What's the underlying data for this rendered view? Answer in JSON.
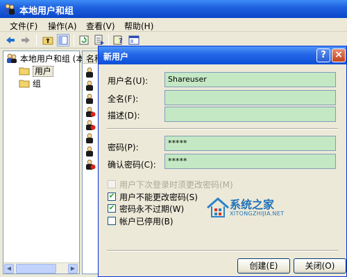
{
  "window": {
    "title": "本地用户和组"
  },
  "menu": [
    {
      "label": "文件(F)"
    },
    {
      "label": "操作(A)"
    },
    {
      "label": "查看(V)"
    },
    {
      "label": "帮助(H)"
    }
  ],
  "toolbar": {
    "buttons": [
      "back-arrow-icon",
      "forward-arrow-icon",
      "up-folder-icon",
      "show-hide-tree-icon",
      "refresh-icon",
      "export-list-icon",
      "help-icon",
      "mmc-console-icon"
    ]
  },
  "tree": {
    "root_label": "本地用户和组 (本",
    "items": [
      {
        "label": "用户"
      },
      {
        "label": "组"
      }
    ]
  },
  "list": {
    "header": "名称",
    "row_count": 8
  },
  "dialog": {
    "title": "新用户",
    "help_button": "?",
    "close_button": "×",
    "username_label": "用户名(U):",
    "username_value": "Shareuser",
    "fullname_label": "全名(F):",
    "fullname_value": "",
    "description_label": "描述(D):",
    "description_value": "",
    "password_label": "密码(P):",
    "password_value": "*****",
    "confirm_label": "确认密码(C):",
    "confirm_value": "*****",
    "checkboxes": [
      {
        "label": "用户下次登录时须更改密码(M)",
        "checked": false,
        "enabled": false
      },
      {
        "label": "用户不能更改密码(S)",
        "checked": true,
        "enabled": true
      },
      {
        "label": "密码永不过期(W)",
        "checked": true,
        "enabled": true
      },
      {
        "label": "帐户已停用(B)",
        "checked": false,
        "enabled": true
      }
    ],
    "create_button": "创建(E)",
    "close_label": "关闭(O)"
  },
  "watermark": {
    "name": "系统之家",
    "url": "XITONGZHIJIA.NET"
  },
  "colors": {
    "titlebar": "#0a46c9",
    "field_filled": "#c4e8c4",
    "dialog_bg": "#ece9d8"
  }
}
